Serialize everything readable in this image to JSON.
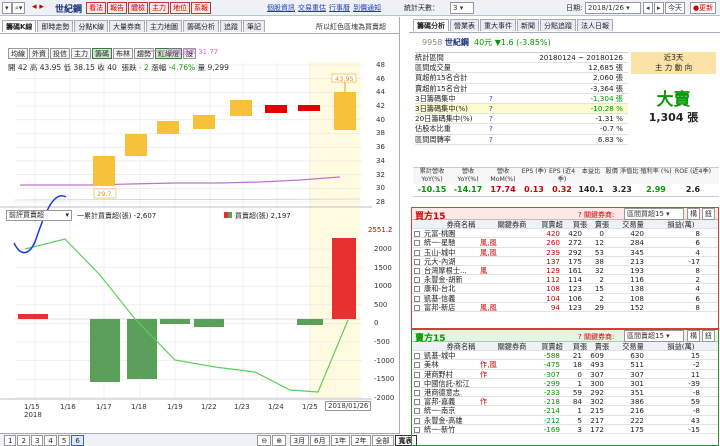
{
  "toolbar": {
    "stock_name": "世紀鋼",
    "red_buttons": [
      "看法",
      "報告",
      "體檢",
      "主力",
      "地位",
      "系報"
    ],
    "links": [
      "個股資訊",
      "交易重估",
      "行事曆",
      "到價通知"
    ],
    "stat_days_label": "統計天數：",
    "stat_days_value": "3",
    "date_label": "日期:",
    "date_value": "2018/1/26",
    "today": "今天",
    "refresh": "更新"
  },
  "left_tabs": [
    "籌碼K線",
    "即時走勢",
    "分點K線",
    "大量券商",
    "主力地圖",
    "籌碼分析",
    "追蹤",
    "筆記"
  ],
  "left_tab_hint": "所以紅色區塊為買賣超",
  "graph_toggles": [
    "均線",
    "外資",
    "投信",
    "主力",
    "籌碼",
    "布林",
    "趨勢",
    "紅綠燈",
    "設"
  ],
  "ohlc": {
    "open_label": "開",
    "open": "42",
    "high_label": "高",
    "high": "43.95",
    "low_label": "低",
    "low": "38.15",
    "close_label": "收",
    "close": "40",
    "chg_label": "張跌",
    "chg": "- 2",
    "pct_label": "漲幅",
    "pct": "-4.76%",
    "vol_label": "量",
    "vol": "9,299"
  },
  "ma_legend": "籌碼成本 31.77",
  "lower_select": "前評買賣超",
  "lower_legend_line": "一累計買賣超(張) -2,607",
  "lower_legend_bar": "買賣超(張) 2,197",
  "lower_top_value": "2551.2",
  "upper_axis": [
    "48",
    "46",
    "44",
    "42",
    "40",
    "38",
    "36",
    "34",
    "32",
    "30",
    "28"
  ],
  "lower_axis": [
    "2000",
    "1500",
    "1000",
    "500",
    "0",
    "-500",
    "-1000",
    "-1500",
    "-2000"
  ],
  "x_dates": [
    "1/15",
    "1/16",
    "1/17",
    "1/18",
    "1/19",
    "1/22",
    "1/23",
    "1/24",
    "1/25",
    "2018/01/26"
  ],
  "x_year": "2018",
  "candle_labels": {
    "high": "43.95",
    "low": "29.7"
  },
  "pager": [
    "1",
    "2",
    "3",
    "4",
    "5",
    "6"
  ],
  "periods": [
    "3月",
    "6月",
    "1年",
    "2年",
    "全部",
    "寬表"
  ],
  "right_tabs": [
    "籌碼分析",
    "營業表",
    "重大事件",
    "新聞",
    "分點追蹤",
    "法人日報"
  ],
  "stock_summary": {
    "code": "9958",
    "name": "世紀鋼",
    "price": "40元",
    "change": "▼1.6 (-3.85%)"
  },
  "stats": [
    {
      "label": "統計區間",
      "value": "20180124 ~ 20180126"
    },
    {
      "label": "區間成交量",
      "value": "12,685 張"
    },
    {
      "label": "買超前15名合計",
      "value": "2,060 張"
    },
    {
      "label": "賣超前15名合計",
      "value": "-3,364 張"
    },
    {
      "label": "3日籌碼集中",
      "value": "-1,304 張"
    },
    {
      "label": "3日籌碼集中(%)",
      "value": "-10.28 %"
    },
    {
      "label": "20日籌碼集中(%)",
      "value": "-1.31 %"
    },
    {
      "label": "佔股本比重",
      "value": "-0.7 %"
    },
    {
      "label": "區間周轉率",
      "value": "6.83 %"
    }
  ],
  "trend_box": {
    "title1": "近3天",
    "title2": "主 力 動 向",
    "verdict": "大賣",
    "amount": "1,304 張"
  },
  "metrics": {
    "headers": [
      "累計營收 YoY(%)",
      "營收 YoY(%)",
      "營收 MoM(%)",
      "EPS (季)",
      "EPS (近4季)",
      "本益比",
      "股價 淨值比",
      "殖利率 (%)",
      "ROE (近4季)"
    ],
    "values": [
      "-10.15",
      "-14.17",
      "17.74",
      "0.13",
      "0.32",
      "140.1",
      "3.23",
      "2.99",
      "2.6"
    ]
  },
  "buy_panel": {
    "title": "買方15",
    "assoc_label": "關鍵券商:",
    "select": "區間買超15",
    "btn1": "構",
    "btn2": "鈕",
    "headers": [
      "券商名稱",
      "關鍵券商",
      "買賣超",
      "買張",
      "賣張",
      "交易量",
      "損益(萬)"
    ],
    "rows": [
      [
        "元富-桃園",
        "",
        "420",
        "420",
        "0",
        "420",
        "8"
      ],
      [
        "統一-星馳",
        "風,風",
        "260",
        "272",
        "12",
        "284",
        "6"
      ],
      [
        "玉山-城中",
        "風,風",
        "239",
        "292",
        "53",
        "345",
        "4"
      ],
      [
        "元大-內湖",
        "",
        "137",
        "175",
        "38",
        "213",
        "-17"
      ],
      [
        "台灣摩根士...",
        "風",
        "129",
        "161",
        "32",
        "193",
        "8"
      ],
      [
        "永豐金-胡新",
        "",
        "112",
        "114",
        "2",
        "116",
        "2"
      ],
      [
        "康和-台北",
        "",
        "108",
        "123",
        "15",
        "138",
        "4"
      ],
      [
        "凱基-信義",
        "",
        "104",
        "106",
        "2",
        "108",
        "6"
      ],
      [
        "富邦-新店",
        "風,風",
        "94",
        "123",
        "29",
        "152",
        "8"
      ]
    ]
  },
  "sell_panel": {
    "title": "賣方15",
    "assoc_label": "關鍵券商:",
    "select": "區間賣超15",
    "btn1": "構",
    "btn2": "鈕",
    "headers": [
      "券商名稱",
      "關鍵券商",
      "買賣超",
      "買張",
      "賣張",
      "交易量",
      "損益(萬)"
    ],
    "rows": [
      [
        "凱基-城中",
        "",
        "-588",
        "21",
        "609",
        "630",
        "15"
      ],
      [
        "美林",
        "作,風",
        "-475",
        "18",
        "493",
        "511",
        "-2"
      ],
      [
        "港商野村",
        "作",
        "-307",
        "0",
        "307",
        "307",
        "11"
      ],
      [
        "中國信託-松江",
        "",
        "-299",
        "1",
        "300",
        "301",
        "-39"
      ],
      [
        "港商德意志",
        "",
        "-233",
        "59",
        "292",
        "351",
        "-8"
      ],
      [
        "富邦-嘉義",
        "作",
        "-218",
        "84",
        "302",
        "386",
        "59"
      ],
      [
        "統一-南京",
        "",
        "-214",
        "1",
        "215",
        "216",
        "-8"
      ],
      [
        "永豐金-高雄",
        "",
        "-212",
        "5",
        "217",
        "222",
        "43"
      ],
      [
        "統一-新竹",
        "",
        "-169",
        "3",
        "172",
        "175",
        "-15"
      ]
    ]
  }
}
